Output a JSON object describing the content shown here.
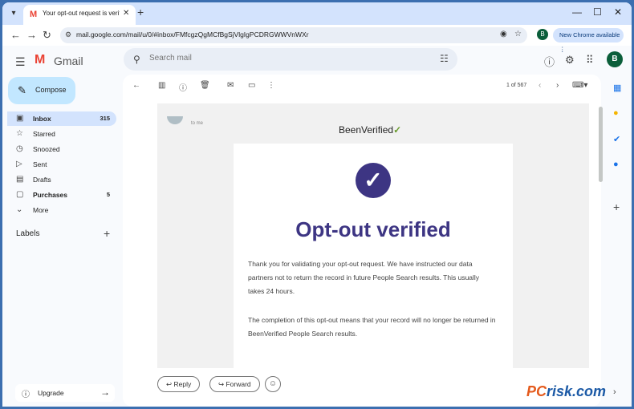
{
  "browser": {
    "tab_title": "Your opt-out request is verified",
    "url": "mail.google.com/mail/u/0/#inbox/FMfcgzQgMCfBgSjVlgIgPCDRGWWVnWXr",
    "profile_initial": "B",
    "new_chrome_label": "New Chrome available",
    "icons": [
      "chevron-down",
      "close",
      "plus",
      "minimize",
      "maximize",
      "back",
      "forward",
      "reload",
      "eye",
      "star"
    ]
  },
  "header": {
    "app_name": "Gmail",
    "search_placeholder": "Search mail",
    "avatar_initial": "B"
  },
  "sidebar": {
    "compose_label": "Compose",
    "items": [
      {
        "label": "Inbox",
        "count": "315",
        "icon": "inbox",
        "active": true,
        "bold": true
      },
      {
        "label": "Starred",
        "count": "",
        "icon": "star"
      },
      {
        "label": "Snoozed",
        "count": "",
        "icon": "clock"
      },
      {
        "label": "Sent",
        "count": "",
        "icon": "send"
      },
      {
        "label": "Drafts",
        "count": "",
        "icon": "draft"
      },
      {
        "label": "Purchases",
        "count": "5",
        "icon": "tag",
        "bold": true
      },
      {
        "label": "More",
        "count": "",
        "icon": "chevron-down"
      }
    ],
    "labels_title": "Labels",
    "upgrade_label": "Upgrade"
  },
  "toolbar": {
    "pager": "1 of 567"
  },
  "email": {
    "recipient": "to me",
    "brand": "BeenVerified",
    "heading": "Opt-out verified",
    "paragraph1": "Thank you for validating your opt-out request. We have instructed our data partners not to return the record in future People Search results. This usually takes 24 hours.",
    "paragraph2": "The completion of this opt-out means that your record will no longer be returned in BeenVerified People Search results."
  },
  "actions": {
    "reply_label": "Reply",
    "forward_label": "Forward"
  },
  "watermark": {
    "part1": "PC",
    "part2": "risk.com"
  },
  "colors": {
    "accent": "#3d3583",
    "compose": "#c2e7ff",
    "inbox_active": "#d3e3fd"
  }
}
